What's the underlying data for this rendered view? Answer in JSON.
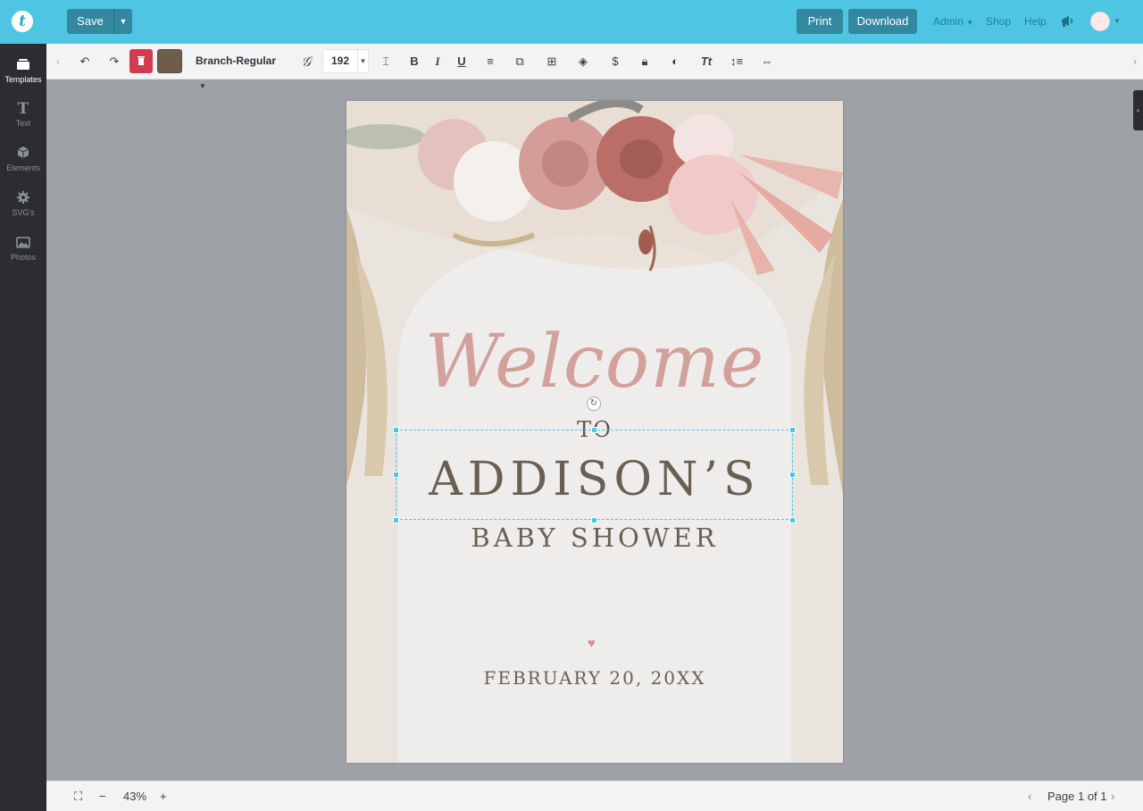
{
  "topbar": {
    "logo": "t",
    "save_label": "Save",
    "print_label": "Print",
    "download_label": "Download",
    "admin_label": "Admin",
    "shop_label": "Shop",
    "help_label": "Help"
  },
  "sidebar": {
    "items": [
      {
        "label": "Templates",
        "icon": "templates-icon"
      },
      {
        "label": "Text",
        "icon": "text-icon"
      },
      {
        "label": "Elements",
        "icon": "elements-icon"
      },
      {
        "label": "SVG's",
        "icon": "svg-gear-icon"
      },
      {
        "label": "Photos",
        "icon": "photos-icon"
      }
    ]
  },
  "toolbar": {
    "font_name": "Branch-Regular",
    "font_size": "192",
    "bold": "B",
    "italic": "I",
    "underline": "U",
    "text_style": "Tt",
    "swatch_color": "#6e5d4c"
  },
  "design": {
    "welcome": "Welcome",
    "to": "TO",
    "name": "ADDISON’S",
    "event": "BABY SHOWER",
    "heart": "♥",
    "date": "FEBRUARY 20, 20XX"
  },
  "bottombar": {
    "zoom": "43%",
    "page_label": "Page 1 of 1"
  },
  "colors": {
    "accent": "#4ec6e3",
    "button": "#33879e",
    "delete": "#d23c4e"
  }
}
